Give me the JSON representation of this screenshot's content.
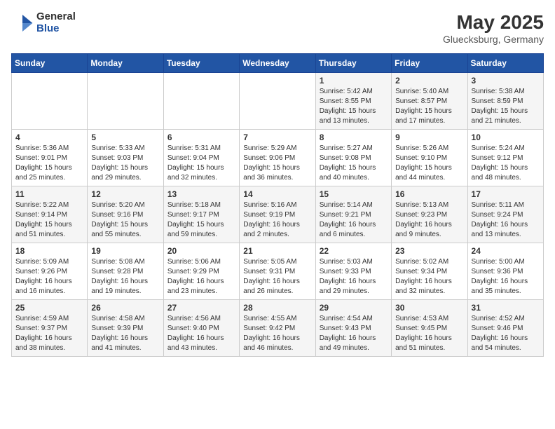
{
  "header": {
    "logo": {
      "general": "General",
      "blue": "Blue"
    },
    "title": "May 2025",
    "location": "Gluecksburg, Germany"
  },
  "calendar": {
    "weekdays": [
      "Sunday",
      "Monday",
      "Tuesday",
      "Wednesday",
      "Thursday",
      "Friday",
      "Saturday"
    ],
    "weeks": [
      [
        {
          "day": "",
          "sunrise": "",
          "sunset": "",
          "daylight": ""
        },
        {
          "day": "",
          "sunrise": "",
          "sunset": "",
          "daylight": ""
        },
        {
          "day": "",
          "sunrise": "",
          "sunset": "",
          "daylight": ""
        },
        {
          "day": "",
          "sunrise": "",
          "sunset": "",
          "daylight": ""
        },
        {
          "day": "1",
          "sunrise": "Sunrise: 5:42 AM",
          "sunset": "Sunset: 8:55 PM",
          "daylight": "Daylight: 15 hours and 13 minutes."
        },
        {
          "day": "2",
          "sunrise": "Sunrise: 5:40 AM",
          "sunset": "Sunset: 8:57 PM",
          "daylight": "Daylight: 15 hours and 17 minutes."
        },
        {
          "day": "3",
          "sunrise": "Sunrise: 5:38 AM",
          "sunset": "Sunset: 8:59 PM",
          "daylight": "Daylight: 15 hours and 21 minutes."
        }
      ],
      [
        {
          "day": "4",
          "sunrise": "Sunrise: 5:36 AM",
          "sunset": "Sunset: 9:01 PM",
          "daylight": "Daylight: 15 hours and 25 minutes."
        },
        {
          "day": "5",
          "sunrise": "Sunrise: 5:33 AM",
          "sunset": "Sunset: 9:03 PM",
          "daylight": "Daylight: 15 hours and 29 minutes."
        },
        {
          "day": "6",
          "sunrise": "Sunrise: 5:31 AM",
          "sunset": "Sunset: 9:04 PM",
          "daylight": "Daylight: 15 hours and 32 minutes."
        },
        {
          "day": "7",
          "sunrise": "Sunrise: 5:29 AM",
          "sunset": "Sunset: 9:06 PM",
          "daylight": "Daylight: 15 hours and 36 minutes."
        },
        {
          "day": "8",
          "sunrise": "Sunrise: 5:27 AM",
          "sunset": "Sunset: 9:08 PM",
          "daylight": "Daylight: 15 hours and 40 minutes."
        },
        {
          "day": "9",
          "sunrise": "Sunrise: 5:26 AM",
          "sunset": "Sunset: 9:10 PM",
          "daylight": "Daylight: 15 hours and 44 minutes."
        },
        {
          "day": "10",
          "sunrise": "Sunrise: 5:24 AM",
          "sunset": "Sunset: 9:12 PM",
          "daylight": "Daylight: 15 hours and 48 minutes."
        }
      ],
      [
        {
          "day": "11",
          "sunrise": "Sunrise: 5:22 AM",
          "sunset": "Sunset: 9:14 PM",
          "daylight": "Daylight: 15 hours and 51 minutes."
        },
        {
          "day": "12",
          "sunrise": "Sunrise: 5:20 AM",
          "sunset": "Sunset: 9:16 PM",
          "daylight": "Daylight: 15 hours and 55 minutes."
        },
        {
          "day": "13",
          "sunrise": "Sunrise: 5:18 AM",
          "sunset": "Sunset: 9:17 PM",
          "daylight": "Daylight: 15 hours and 59 minutes."
        },
        {
          "day": "14",
          "sunrise": "Sunrise: 5:16 AM",
          "sunset": "Sunset: 9:19 PM",
          "daylight": "Daylight: 16 hours and 2 minutes."
        },
        {
          "day": "15",
          "sunrise": "Sunrise: 5:14 AM",
          "sunset": "Sunset: 9:21 PM",
          "daylight": "Daylight: 16 hours and 6 minutes."
        },
        {
          "day": "16",
          "sunrise": "Sunrise: 5:13 AM",
          "sunset": "Sunset: 9:23 PM",
          "daylight": "Daylight: 16 hours and 9 minutes."
        },
        {
          "day": "17",
          "sunrise": "Sunrise: 5:11 AM",
          "sunset": "Sunset: 9:24 PM",
          "daylight": "Daylight: 16 hours and 13 minutes."
        }
      ],
      [
        {
          "day": "18",
          "sunrise": "Sunrise: 5:09 AM",
          "sunset": "Sunset: 9:26 PM",
          "daylight": "Daylight: 16 hours and 16 minutes."
        },
        {
          "day": "19",
          "sunrise": "Sunrise: 5:08 AM",
          "sunset": "Sunset: 9:28 PM",
          "daylight": "Daylight: 16 hours and 19 minutes."
        },
        {
          "day": "20",
          "sunrise": "Sunrise: 5:06 AM",
          "sunset": "Sunset: 9:29 PM",
          "daylight": "Daylight: 16 hours and 23 minutes."
        },
        {
          "day": "21",
          "sunrise": "Sunrise: 5:05 AM",
          "sunset": "Sunset: 9:31 PM",
          "daylight": "Daylight: 16 hours and 26 minutes."
        },
        {
          "day": "22",
          "sunrise": "Sunrise: 5:03 AM",
          "sunset": "Sunset: 9:33 PM",
          "daylight": "Daylight: 16 hours and 29 minutes."
        },
        {
          "day": "23",
          "sunrise": "Sunrise: 5:02 AM",
          "sunset": "Sunset: 9:34 PM",
          "daylight": "Daylight: 16 hours and 32 minutes."
        },
        {
          "day": "24",
          "sunrise": "Sunrise: 5:00 AM",
          "sunset": "Sunset: 9:36 PM",
          "daylight": "Daylight: 16 hours and 35 minutes."
        }
      ],
      [
        {
          "day": "25",
          "sunrise": "Sunrise: 4:59 AM",
          "sunset": "Sunset: 9:37 PM",
          "daylight": "Daylight: 16 hours and 38 minutes."
        },
        {
          "day": "26",
          "sunrise": "Sunrise: 4:58 AM",
          "sunset": "Sunset: 9:39 PM",
          "daylight": "Daylight: 16 hours and 41 minutes."
        },
        {
          "day": "27",
          "sunrise": "Sunrise: 4:56 AM",
          "sunset": "Sunset: 9:40 PM",
          "daylight": "Daylight: 16 hours and 43 minutes."
        },
        {
          "day": "28",
          "sunrise": "Sunrise: 4:55 AM",
          "sunset": "Sunset: 9:42 PM",
          "daylight": "Daylight: 16 hours and 46 minutes."
        },
        {
          "day": "29",
          "sunrise": "Sunrise: 4:54 AM",
          "sunset": "Sunset: 9:43 PM",
          "daylight": "Daylight: 16 hours and 49 minutes."
        },
        {
          "day": "30",
          "sunrise": "Sunrise: 4:53 AM",
          "sunset": "Sunset: 9:45 PM",
          "daylight": "Daylight: 16 hours and 51 minutes."
        },
        {
          "day": "31",
          "sunrise": "Sunrise: 4:52 AM",
          "sunset": "Sunset: 9:46 PM",
          "daylight": "Daylight: 16 hours and 54 minutes."
        }
      ]
    ]
  }
}
